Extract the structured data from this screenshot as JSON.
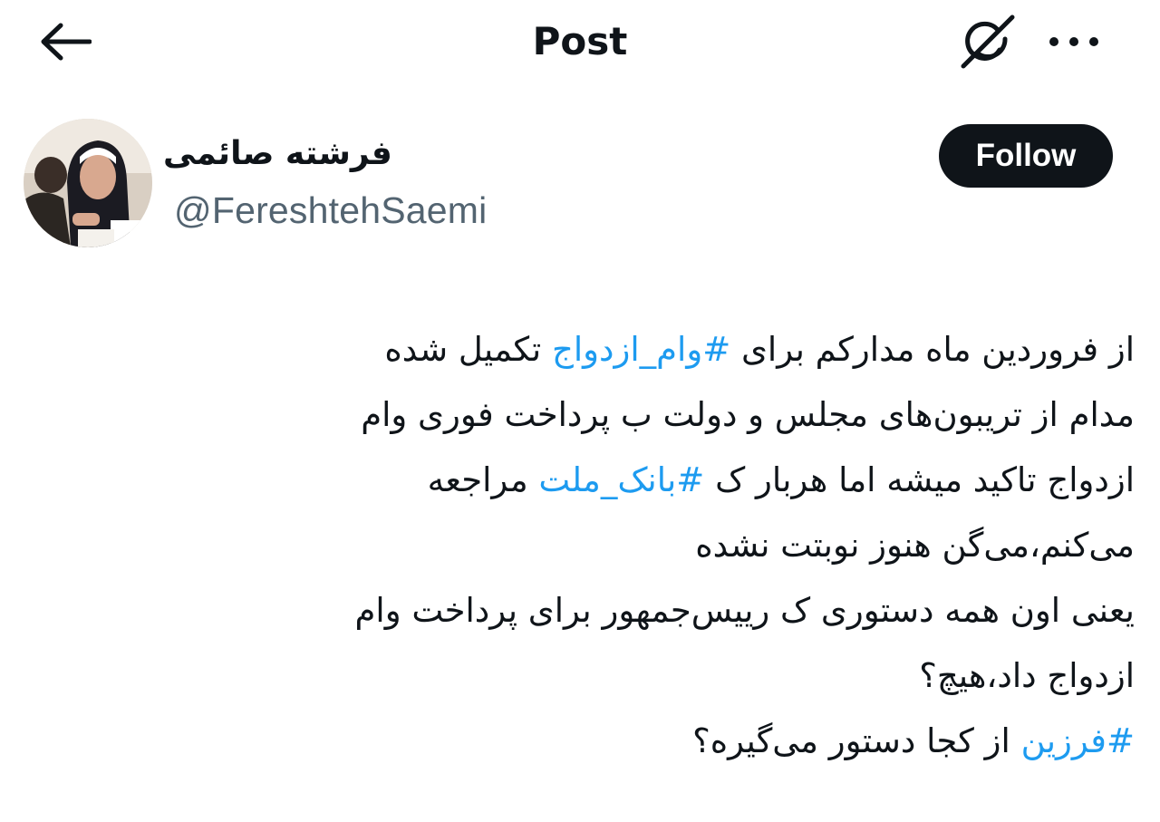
{
  "header": {
    "title": "Post",
    "icons": {
      "back": "arrow-left-icon",
      "grok": "grok-icon",
      "more": "more-horizontal-icon"
    }
  },
  "author": {
    "name": "فرشته صائمی",
    "handle": "@FereshtehSaemi",
    "follow_label": "Follow"
  },
  "tweet": {
    "lines": [
      {
        "before": "از فروردین ماه مدارکم برای ",
        "hashtag": "#وام_ازدواج",
        "after": " تکمیل شده"
      },
      {
        "before": "مدام از تریبون‌های مجلس و دولت ب پرداخت فوری وام",
        "hashtag": "",
        "after": ""
      },
      {
        "before": "ازدواج تاکید میشه اما هربار ک ",
        "hashtag": "#بانک_ملت",
        "after": " مراجعه"
      },
      {
        "before": "می‌کنم،می‌گن هنوز نوبتت نشده",
        "hashtag": "",
        "after": ""
      },
      {
        "before": "یعنی اون همه دستوری ک رییس‌جمهور برای پرداخت وام",
        "hashtag": "",
        "after": ""
      },
      {
        "before": "ازدواج داد،هیچ؟",
        "hashtag": "",
        "after": ""
      },
      {
        "before": "",
        "hashtag": "#فرزین",
        "after": " از کجا دستور می‌گیره؟"
      }
    ]
  },
  "colors": {
    "text": "#0f1419",
    "secondary": "#536471",
    "link": "#1d9bf0",
    "button_bg": "#0f1419",
    "button_text": "#ffffff"
  }
}
